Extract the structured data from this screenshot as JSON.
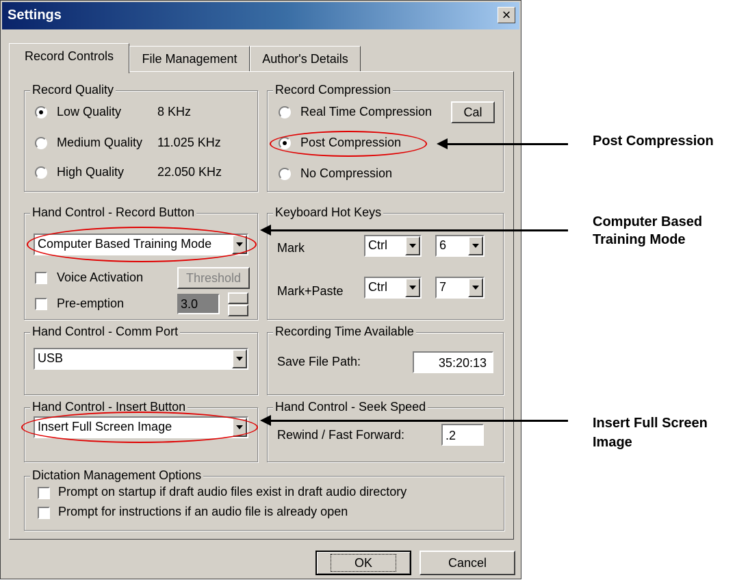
{
  "window": {
    "title": "Settings",
    "close_glyph": "×"
  },
  "tabs": [
    "Record Controls",
    "File Management",
    "Author's Details"
  ],
  "record_quality": {
    "legend": "Record Quality",
    "options": [
      {
        "label": "Low Quality",
        "rate": "8 KHz",
        "selected": true
      },
      {
        "label": "Medium Quality",
        "rate": "11.025 KHz",
        "selected": false
      },
      {
        "label": "High Quality",
        "rate": "22.050 KHz",
        "selected": false
      }
    ]
  },
  "record_compression": {
    "legend": "Record Compression",
    "options": [
      "Real Time Compression",
      "Post Compression",
      "No Compression"
    ],
    "selected": "Post Compression",
    "cal_label": "Cal"
  },
  "record_button": {
    "legend": "Hand Control - Record Button",
    "mode": "Computer Based Training Mode",
    "voice_activation": "Voice Activation",
    "threshold": "Threshold",
    "preemption": "Pre-emption",
    "preemption_value": "3.0"
  },
  "hot_keys": {
    "legend": "Keyboard Hot Keys",
    "mark": "Mark",
    "mark_mod": "Ctrl",
    "mark_key": "6",
    "mark_paste": "Mark+Paste",
    "paste_mod": "Ctrl",
    "paste_key": "7"
  },
  "comm_port": {
    "legend": "Hand Control - Comm Port",
    "value": "USB"
  },
  "recording_time": {
    "legend": "Recording Time Available",
    "label": "Save File Path:",
    "value": "35:20:13"
  },
  "insert_button": {
    "legend": "Hand Control - Insert Button",
    "value": "Insert Full Screen Image"
  },
  "seek_speed": {
    "legend": "Hand Control - Seek Speed",
    "label": "Rewind / Fast Forward:",
    "value": ".2"
  },
  "dictation": {
    "legend": "Dictation Management Options",
    "options": [
      "Prompt on startup if draft audio files exist in draft audio directory",
      "Prompt for instructions if an audio file is already open"
    ]
  },
  "buttons": {
    "ok": "OK",
    "cancel": "Cancel"
  },
  "annotations": {
    "post": "Post Compression",
    "cbt_1": "Computer Based",
    "cbt_2": "Training Mode",
    "insert_1": "Insert Full Screen",
    "insert_2": "Image"
  },
  "colors": {
    "highlight": "#e00000",
    "titlebar": "#0a246a",
    "face": "#d4d0c8"
  }
}
